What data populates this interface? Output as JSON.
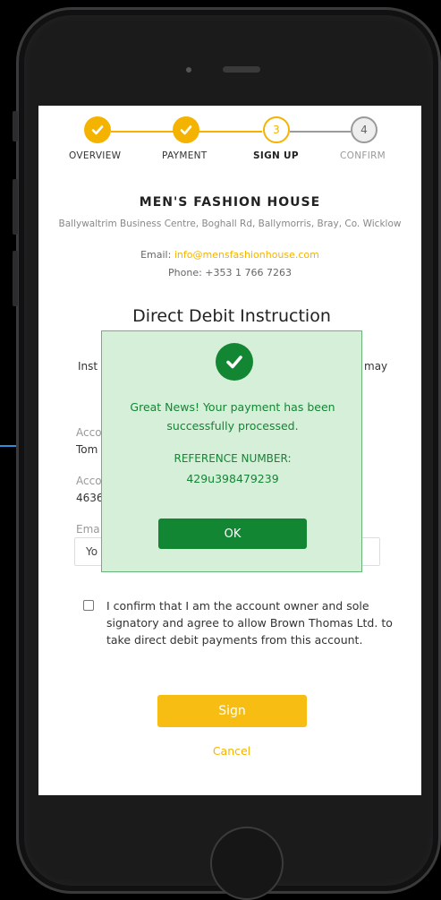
{
  "stepper": {
    "steps": [
      {
        "label": "OVERVIEW",
        "state": "done",
        "number": ""
      },
      {
        "label": "PAYMENT",
        "state": "done",
        "number": ""
      },
      {
        "label": "SIGN UP",
        "state": "current",
        "number": "3"
      },
      {
        "label": "CONFIRM",
        "state": "todo",
        "number": "4"
      }
    ],
    "accent_color": "#f5b301"
  },
  "merchant": {
    "name": "MEN'S FASHION HOUSE",
    "address": "Ballywaltrim Business Centre, Boghall Rd, Ballymorris, Bray, Co. Wicklow",
    "email_label": "Email:",
    "email": "info@mensfashionhouse.com",
    "phone": "Phone: +353 1 766 7263"
  },
  "form": {
    "title": "Direct Debit Instruction",
    "instructions_left": "Inst",
    "instructions_right": "may",
    "account_name_label": "Acco",
    "account_name_value": "Tom",
    "account_number_label": "Acco",
    "account_number_value": "4636",
    "email_label": "Ema",
    "email_placeholder": "Yo"
  },
  "confirmation": {
    "text": "I confirm that I am the account owner and sole signatory and agree to allow Brown Thomas Ltd. to take direct debit payments from this account."
  },
  "actions": {
    "sign_label": "Sign",
    "cancel_label": "Cancel"
  },
  "modal": {
    "message": "Great News! Your payment has been successfully processed.",
    "reference_label": "REFERENCE NUMBER:",
    "reference_number": "429u398479239",
    "ok_label": "OK",
    "success_color": "#138634",
    "background_color": "#d6efd9"
  }
}
